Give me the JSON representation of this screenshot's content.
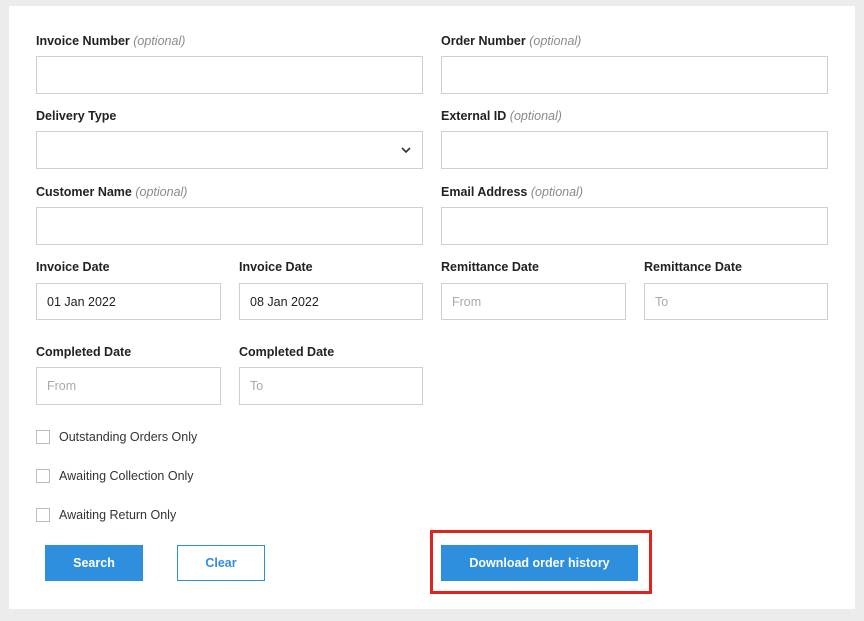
{
  "form": {
    "invoice_number": {
      "label": "Invoice Number",
      "optional": "(optional)",
      "value": ""
    },
    "order_number": {
      "label": "Order Number",
      "optional": "(optional)",
      "value": ""
    },
    "delivery_type": {
      "label": "Delivery Type",
      "value": ""
    },
    "external_id": {
      "label": "External ID",
      "optional": "(optional)",
      "value": ""
    },
    "customer_name": {
      "label": "Customer Name",
      "optional": "(optional)",
      "value": ""
    },
    "email_address": {
      "label": "Email Address",
      "optional": "(optional)",
      "value": ""
    },
    "invoice_date_from": {
      "label": "Invoice Date",
      "value": "01 Jan 2022"
    },
    "invoice_date_to": {
      "label": "Invoice Date",
      "value": "08 Jan 2022"
    },
    "remittance_date_from": {
      "label": "Remittance Date",
      "placeholder": "From"
    },
    "remittance_date_to": {
      "label": "Remittance Date",
      "placeholder": "To"
    },
    "completed_date_from": {
      "label": "Completed Date",
      "placeholder": "From"
    },
    "completed_date_to": {
      "label": "Completed Date",
      "placeholder": "To"
    }
  },
  "checkboxes": [
    {
      "label": "Outstanding Orders Only",
      "checked": false
    },
    {
      "label": "Awaiting Collection Only",
      "checked": false
    },
    {
      "label": "Awaiting Return Only",
      "checked": false
    }
  ],
  "buttons": {
    "search": "Search",
    "clear": "Clear",
    "download": "Download order history"
  },
  "colors": {
    "primary": "#2f8fdf",
    "highlight": "#e0231b",
    "border": "#cfcfcf",
    "background": "#ececec"
  }
}
